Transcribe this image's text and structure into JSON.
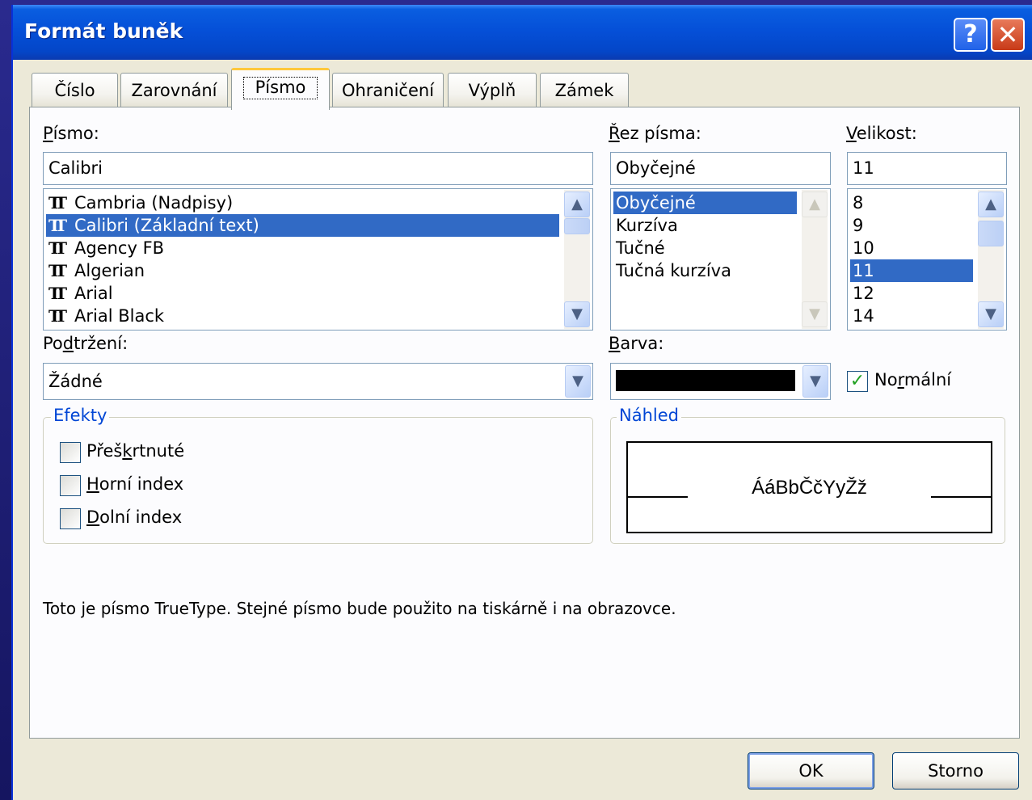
{
  "window": {
    "title": "Formát buněk"
  },
  "tabs": [
    {
      "label": "Číslo"
    },
    {
      "label": "Zarovnání"
    },
    {
      "label": "Písmo"
    },
    {
      "label": "Ohraničení"
    },
    {
      "label": "Výplň"
    },
    {
      "label": "Zámek"
    }
  ],
  "active_tab": "Písmo",
  "font": {
    "label": "Písmo:",
    "value": "Calibri",
    "items": [
      {
        "name": "Cambria (Nadpisy)",
        "selected": false
      },
      {
        "name": "Calibri (Základní text)",
        "selected": true
      },
      {
        "name": "Agency FB",
        "selected": false
      },
      {
        "name": "Algerian",
        "selected": false
      },
      {
        "name": "Arial",
        "selected": false
      },
      {
        "name": "Arial Black",
        "selected": false
      }
    ]
  },
  "style": {
    "label": "Řez písma:",
    "value": "Obyčejné",
    "items": [
      "Obyčejné",
      "Kurzíva",
      "Tučné",
      "Tučná kurzíva"
    ],
    "selected_index": 0
  },
  "size": {
    "label": "Velikost:",
    "value": "11",
    "items": [
      "8",
      "9",
      "10",
      "11",
      "12",
      "14"
    ],
    "selected_index": 3
  },
  "underline": {
    "label": "Podtržení:",
    "value": "Žádné"
  },
  "color": {
    "label": "Barva:",
    "swatch": "#000000",
    "normal_label": "Normální",
    "normal_checked": true
  },
  "effects": {
    "title": "Efekty",
    "items": [
      {
        "label": "Přeškrtnuté",
        "checked": false
      },
      {
        "label": "Horní index",
        "checked": false
      },
      {
        "label": "Dolní index",
        "checked": false
      }
    ]
  },
  "preview": {
    "title": "Náhled",
    "sample": "ÁáBbČčYyŽž"
  },
  "info": "Toto je písmo TrueType. Stejné písmo bude použito na tiskárně i na obrazovce.",
  "buttons": {
    "ok": "OK",
    "cancel": "Storno"
  },
  "icons": {
    "font_type": "truetype-icon",
    "help": "help-icon",
    "close": "close-icon"
  },
  "colors": {
    "titlebar": "#0550d8",
    "selection": "#316ac5",
    "group_title": "#0046d5",
    "dialog_bg": "#ece9d8"
  }
}
